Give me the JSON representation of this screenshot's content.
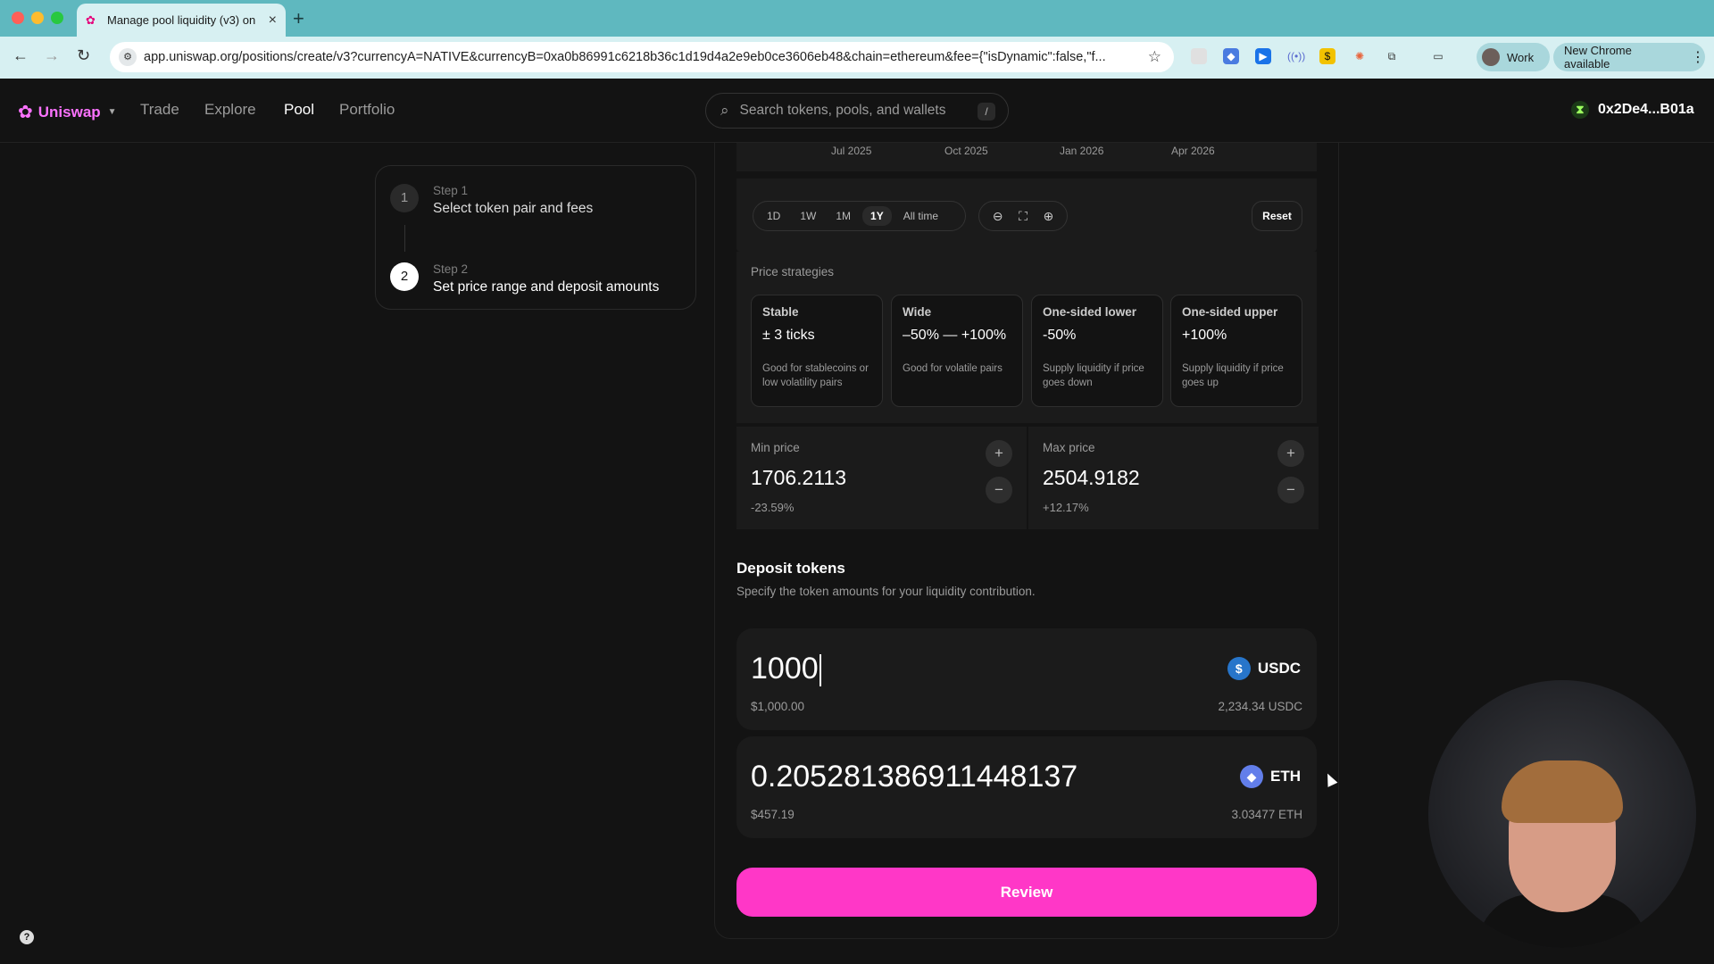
{
  "browser": {
    "tab_title": "Manage pool liquidity (v3) on",
    "url": "app.uniswap.org/positions/create/v3?currencyA=NATIVE&currencyB=0xa0b86991c6218b36c1d19d4a2e9eb0ce3606eb48&chain=ethereum&fee={\"isDynamic\":false,\"f...",
    "profile_label": "Work",
    "update_label": "New Chrome available"
  },
  "header": {
    "brand": "Uniswap",
    "nav": [
      "Trade",
      "Explore",
      "Pool",
      "Portfolio"
    ],
    "active_nav": "Pool",
    "search_placeholder": "Search tokens, pools, and wallets",
    "search_shortcut": "/",
    "wallet_address": "0x2De4...B01a"
  },
  "steps": [
    {
      "label": "Step 1",
      "description": "Select token pair and fees",
      "num": "1"
    },
    {
      "label": "Step 2",
      "description": "Set price range and deposit amounts",
      "num": "2"
    }
  ],
  "chart": {
    "x_ticks": [
      "Jul 2025",
      "Oct 2025",
      "Jan 2026",
      "Apr 2026"
    ],
    "ranges": [
      "1D",
      "1W",
      "1M",
      "1Y",
      "All time"
    ],
    "active_range": "1Y",
    "reset_label": "Reset"
  },
  "strategies": {
    "title": "Price strategies",
    "items": [
      {
        "name": "Stable",
        "value": "± 3 ticks",
        "note": "Good for stablecoins or low volatility pairs"
      },
      {
        "name": "Wide",
        "value": "–50% — +100%",
        "note": "Good for volatile pairs"
      },
      {
        "name": "One-sided lower",
        "value": "-50%",
        "note": "Supply liquidity if price goes down"
      },
      {
        "name": "One-sided upper",
        "value": "+100%",
        "note": "Supply liquidity if price goes up"
      }
    ]
  },
  "prices": {
    "min": {
      "label": "Min price",
      "value": "1706.2113",
      "pct": "-23.59%"
    },
    "max": {
      "label": "Max price",
      "value": "2504.9182",
      "pct": "+12.17%"
    }
  },
  "deposit": {
    "title": "Deposit tokens",
    "subtitle": "Specify the token amounts for your liquidity contribution.",
    "token_a": {
      "amount": "1000",
      "usd": "$1,000.00",
      "symbol": "USDC",
      "balance": "2,234.34 USDC",
      "color": "#2775ca"
    },
    "token_b": {
      "amount": "0.205281386911448137",
      "usd": "$457.19",
      "symbol": "ETH",
      "balance": "3.03477 ETH",
      "color": "#627eea"
    }
  },
  "review_label": "Review",
  "colors": {
    "accent": "#ff37c7",
    "brand": "#fc72ff"
  }
}
